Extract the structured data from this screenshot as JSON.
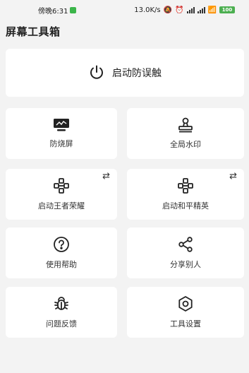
{
  "status_bar": {
    "time": "傍晚6:31",
    "speed": "13.0K/s",
    "battery": "100"
  },
  "page_title": "屏幕工具箱",
  "main_action": {
    "label": "启动防误触",
    "icon": "power-icon"
  },
  "tiles": [
    {
      "label": "防烧屏",
      "icon": "monitor-icon",
      "swap": false
    },
    {
      "label": "全局水印",
      "icon": "stamp-icon",
      "swap": false
    },
    {
      "label": "启动王者荣耀",
      "icon": "gamepad-icon",
      "swap": true,
      "swap_symbol": "⇄"
    },
    {
      "label": "启动和平精英",
      "icon": "gamepad-icon",
      "swap": true,
      "swap_symbol": "⇄"
    },
    {
      "label": "使用帮助",
      "icon": "help-icon",
      "swap": false
    },
    {
      "label": "分享别人",
      "icon": "share-icon",
      "swap": false
    },
    {
      "label": "问题反馈",
      "icon": "bug-icon",
      "swap": false
    },
    {
      "label": "工具设置",
      "icon": "settings-icon",
      "swap": false
    }
  ]
}
